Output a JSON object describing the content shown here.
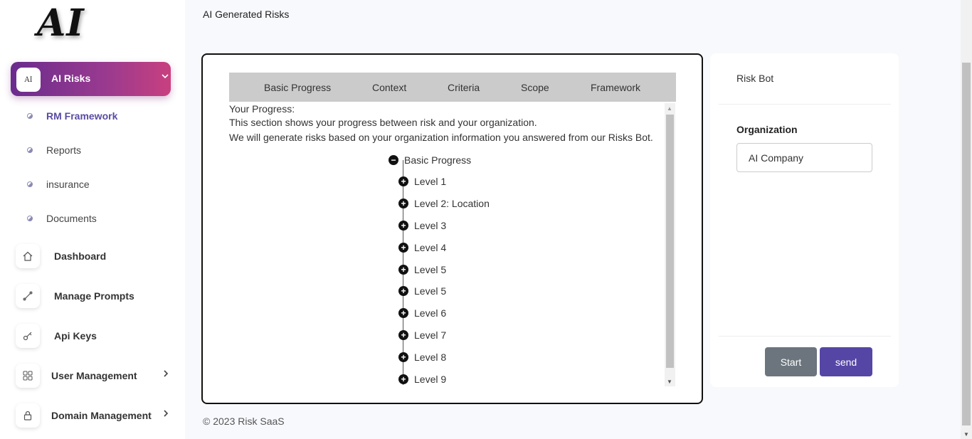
{
  "logo": {
    "text": "AI"
  },
  "sidebar": {
    "active_group": {
      "badge": "AI",
      "label": "AI Risks"
    },
    "sub_items": [
      {
        "label": "RM Framework",
        "active": true
      },
      {
        "label": "Reports"
      },
      {
        "label": "insurance"
      },
      {
        "label": "Documents"
      }
    ],
    "nav_items": [
      {
        "label": "Dashboard",
        "icon": "home-icon"
      },
      {
        "label": "Manage Prompts",
        "icon": "prompt-icon"
      },
      {
        "label": "Api Keys",
        "icon": "key-icon"
      },
      {
        "label": "User Management",
        "icon": "grid-icon"
      },
      {
        "label": "Domain Management",
        "icon": "lock-icon"
      }
    ]
  },
  "header": {
    "title": "AI Generated Risks"
  },
  "main": {
    "tabs": [
      "Basic Progress",
      "Context",
      "Criteria",
      "Scope",
      "Framework"
    ],
    "progress_heading": "Your Progress:",
    "progress_line1": "This section shows your progress between risk and your organization.",
    "progress_line2": "We will generate risks based on your organization information you answered from our Risks Bot.",
    "tree": {
      "root": "Basic Progress",
      "children": [
        "Level 1",
        "Level 2: Location",
        "Level 3",
        "Level 4",
        "Level 5",
        "Level 5",
        "Level 6",
        "Level 7",
        "Level 8",
        "Level 9"
      ]
    }
  },
  "right_panel": {
    "title": "Risk Bot",
    "org_label": "Organization",
    "org_value": "AI Company",
    "start_label": "Start",
    "send_label": "send"
  },
  "footer": {
    "text": "© 2023 Risk SaaS"
  },
  "colors": {
    "accent": "#5546a6",
    "gradient_start": "#6a2c8e",
    "gradient_end": "#c8407f"
  }
}
